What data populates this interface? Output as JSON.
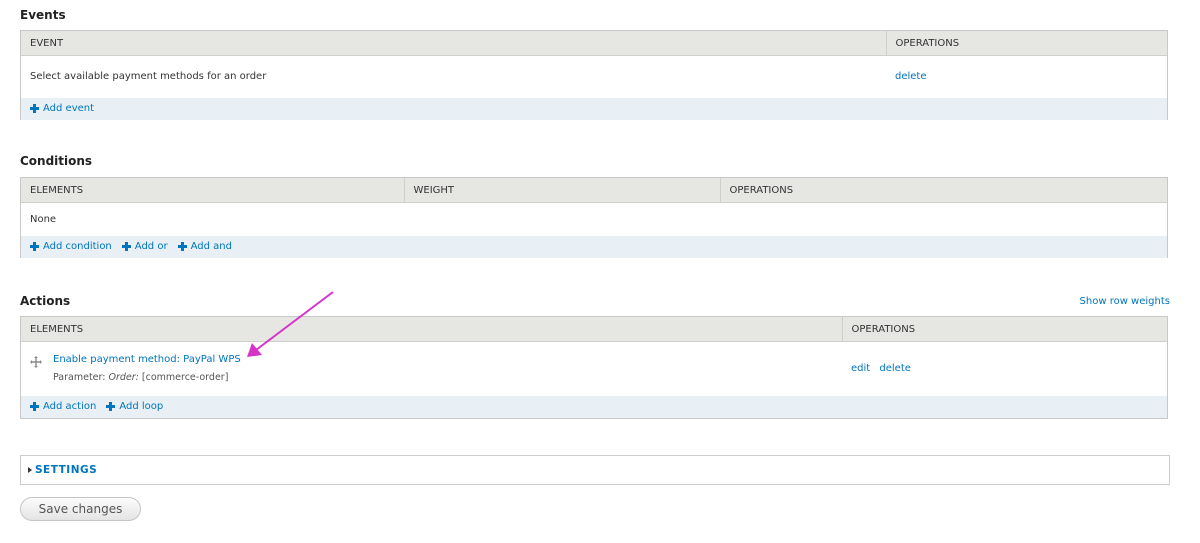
{
  "events": {
    "title": "Events",
    "col_event": "EVENT",
    "col_operations": "OPERATIONS",
    "row_label": "Select available payment methods for an order",
    "row_delete": "delete",
    "add_event": "Add event"
  },
  "conditions": {
    "title": "Conditions",
    "col_elements": "ELEMENTS",
    "col_weight": "WEIGHT",
    "col_operations": "OPERATIONS",
    "row_label": "None",
    "add_condition": "Add condition",
    "add_or": "Add or",
    "add_and": "Add and"
  },
  "actions": {
    "title": "Actions",
    "show_row_weights": "Show row weights",
    "col_elements": "ELEMENTS",
    "col_operations": "OPERATIONS",
    "row_link": "Enable payment method: PayPal WPS",
    "param_prefix": "Parameter:",
    "param_name": "Order:",
    "param_value": "[commerce-order]",
    "row_edit": "edit",
    "row_delete": "delete",
    "add_action": "Add action",
    "add_loop": "Add loop"
  },
  "settings": {
    "label": "SETTINGS"
  },
  "save_button": "Save changes",
  "colors": {
    "link": "#0074bd",
    "annotation_arrow": "#d633c9",
    "header_bg": "#e6e6e2",
    "footer_bg": "#e8f0f5"
  }
}
